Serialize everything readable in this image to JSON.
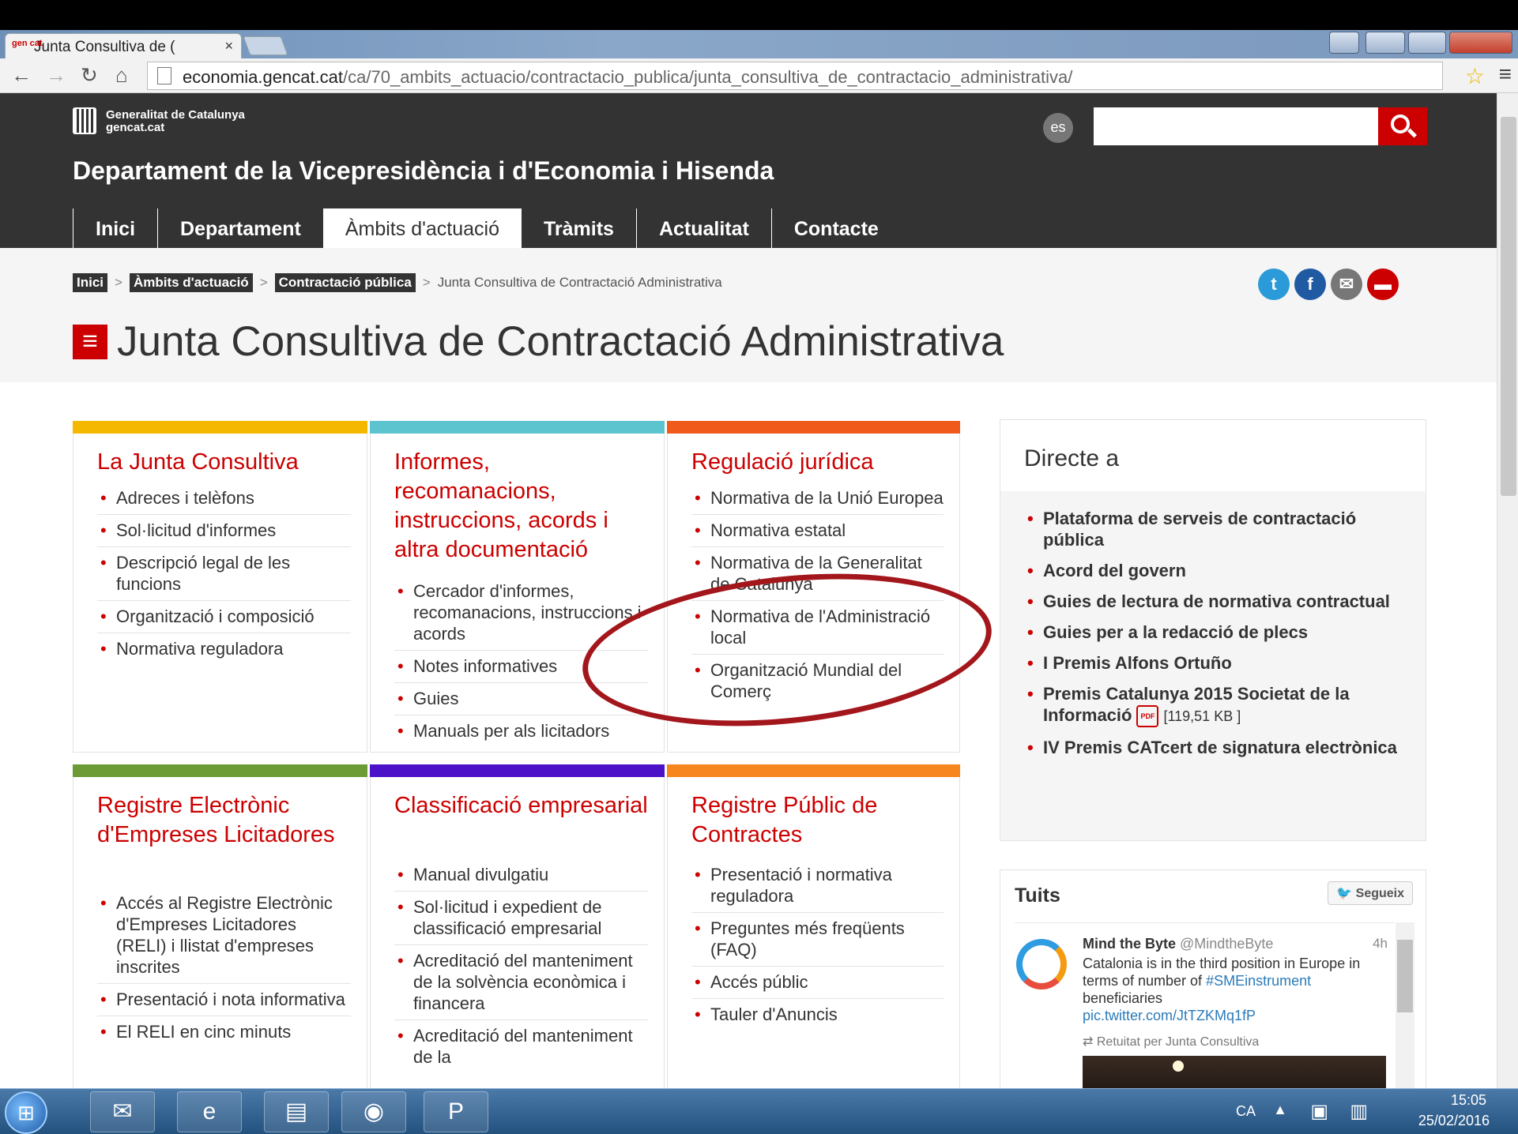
{
  "browser": {
    "tab_title": "Junta Consultiva de (",
    "favicon_text": "gen cat",
    "url_host": "economia.gencat.cat",
    "url_path": "/ca/70_ambits_actuacio/contractacio_publica/junta_consultiva_de_contractacio_administrativa/"
  },
  "header": {
    "logo_line1": "Generalitat de Catalunya",
    "logo_line2": "gencat.cat",
    "lang": "es",
    "search_placeholder": "",
    "department": "Departament de la Vicepresidència i d'Economia i Hisenda",
    "nav": [
      "Inici",
      "Departament",
      "Àmbits d'actuació",
      "Tràmits",
      "Actualitat",
      "Contacte"
    ],
    "active_nav": "Àmbits d'actuació"
  },
  "breadcrumb": {
    "items": [
      "Inici",
      "Àmbits d'actuació",
      "Contractació pública"
    ],
    "current": "Junta Consultiva de Contractació Administrativa",
    "separator": ">"
  },
  "social_icons": [
    "twitter-icon",
    "facebook-icon",
    "email-icon",
    "print-icon"
  ],
  "page_title": "Junta Consultiva de Contractació Administrativa",
  "cards": [
    {
      "title": "La Junta Consultiva",
      "color": "#f5b800",
      "items": [
        "Adreces i telèfons",
        "Sol·licitud d'informes",
        "Descripció legal de les funcions",
        "Organització i composició",
        "Normativa reguladora"
      ]
    },
    {
      "title": "Informes, recomanacions, instruccions, acords i altra documentació",
      "color": "#5bc4cf",
      "items": [
        "Cercador d'informes, recomanacions, instruccions i acords",
        "Notes informatives",
        "Guies",
        "Manuals per als licitadors"
      ]
    },
    {
      "title": "Regulació jurídica",
      "color": "#f05a1a",
      "items": [
        "Normativa de la Unió Europea",
        "Normativa estatal",
        "Normativa de la Generalitat de Catalunya",
        "Normativa de l'Administració local",
        "Organització Mundial del Comerç"
      ]
    },
    {
      "title": "Registre Electrònic d'Empreses Licitadores",
      "color": "#6c9a34",
      "items": [
        "Accés al Registre Electrònic d'Empreses Licitadores (RELI) i llistat d'empreses inscrites",
        "Presentació i nota informativa",
        "El RELI en cinc minuts"
      ]
    },
    {
      "title": "Classificació empresarial",
      "color": "#4b12c8",
      "items": [
        "Manual divulgatiu",
        "Sol·licitud i expedient de classificació empresarial",
        "Acreditació del manteniment de la solvència econòmica i financera",
        "Acreditació del manteniment de la"
      ]
    },
    {
      "title": "Registre Públic de Contractes",
      "color": "#f7861f",
      "items": [
        "Presentació i normativa reguladora",
        "Preguntes més freqüents (FAQ)",
        "Accés públic",
        "Tauler d'Anuncis"
      ]
    }
  ],
  "directe": {
    "title": "Directe a",
    "items": [
      "Plataforma de serveis de contractació pública",
      "Acord del govern",
      "Guies de lectura de normativa contractual",
      "Guies per a la redacció de plecs",
      "I Premis Alfons Ortuño",
      "Premis Catalunya 2015 Societat de la Informació",
      "IV Premis CATcert de signatura electrònica"
    ],
    "pdf_label": "PDF",
    "pdf_size": "[119,51 KB ]"
  },
  "tweets": {
    "title": "Tuits",
    "follow": "Segueix",
    "author": "Mind the Byte",
    "handle": "@MindtheByte",
    "time": "4h",
    "text": "Catalonia is in the third position in Europe in terms of number of",
    "hashtag": "#SMEinstrument",
    "text2": " beneficiaries",
    "link": "pic.twitter.com/JtTZKMq1fP",
    "retweet": "Retuitat per Junta Consultiva"
  },
  "taskbar": {
    "apps": [
      "outlook-icon",
      "internet-explorer-icon",
      "file-explorer-icon",
      "chrome-icon",
      "powerpoint-icon"
    ],
    "lang": "CA",
    "time": "15:05",
    "date": "25/02/2016"
  }
}
